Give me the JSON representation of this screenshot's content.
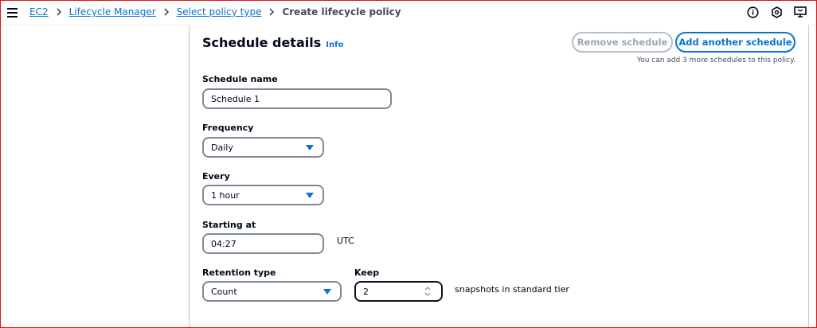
{
  "breadcrumb": {
    "items": [
      "EC2",
      "Lifecycle Manager",
      "Select policy type"
    ],
    "current": "Create lifecycle policy"
  },
  "header_icons": [
    "info-circle-icon",
    "hexagon-settings-icon",
    "feedback-screen-icon"
  ],
  "section": {
    "title": "Schedule details",
    "info_label": "Info",
    "remove_button": "Remove schedule",
    "add_button": "Add another schedule",
    "hint": "You can add 3 more schedules to this policy."
  },
  "form": {
    "schedule_name": {
      "label": "Schedule name",
      "value": "Schedule 1"
    },
    "frequency": {
      "label": "Frequency",
      "value": "Daily"
    },
    "every": {
      "label": "Every",
      "value": "1 hour"
    },
    "starting_at": {
      "label": "Starting at",
      "value": "04:27",
      "suffix": "UTC"
    },
    "retention_type": {
      "label": "Retention type",
      "value": "Count"
    },
    "keep": {
      "label": "Keep",
      "value": "2",
      "suffix": "snapshots in standard tier"
    }
  },
  "colors": {
    "link": "#0972d3",
    "text": "#000716",
    "border": "#7d8998",
    "frame": "#d91515"
  }
}
